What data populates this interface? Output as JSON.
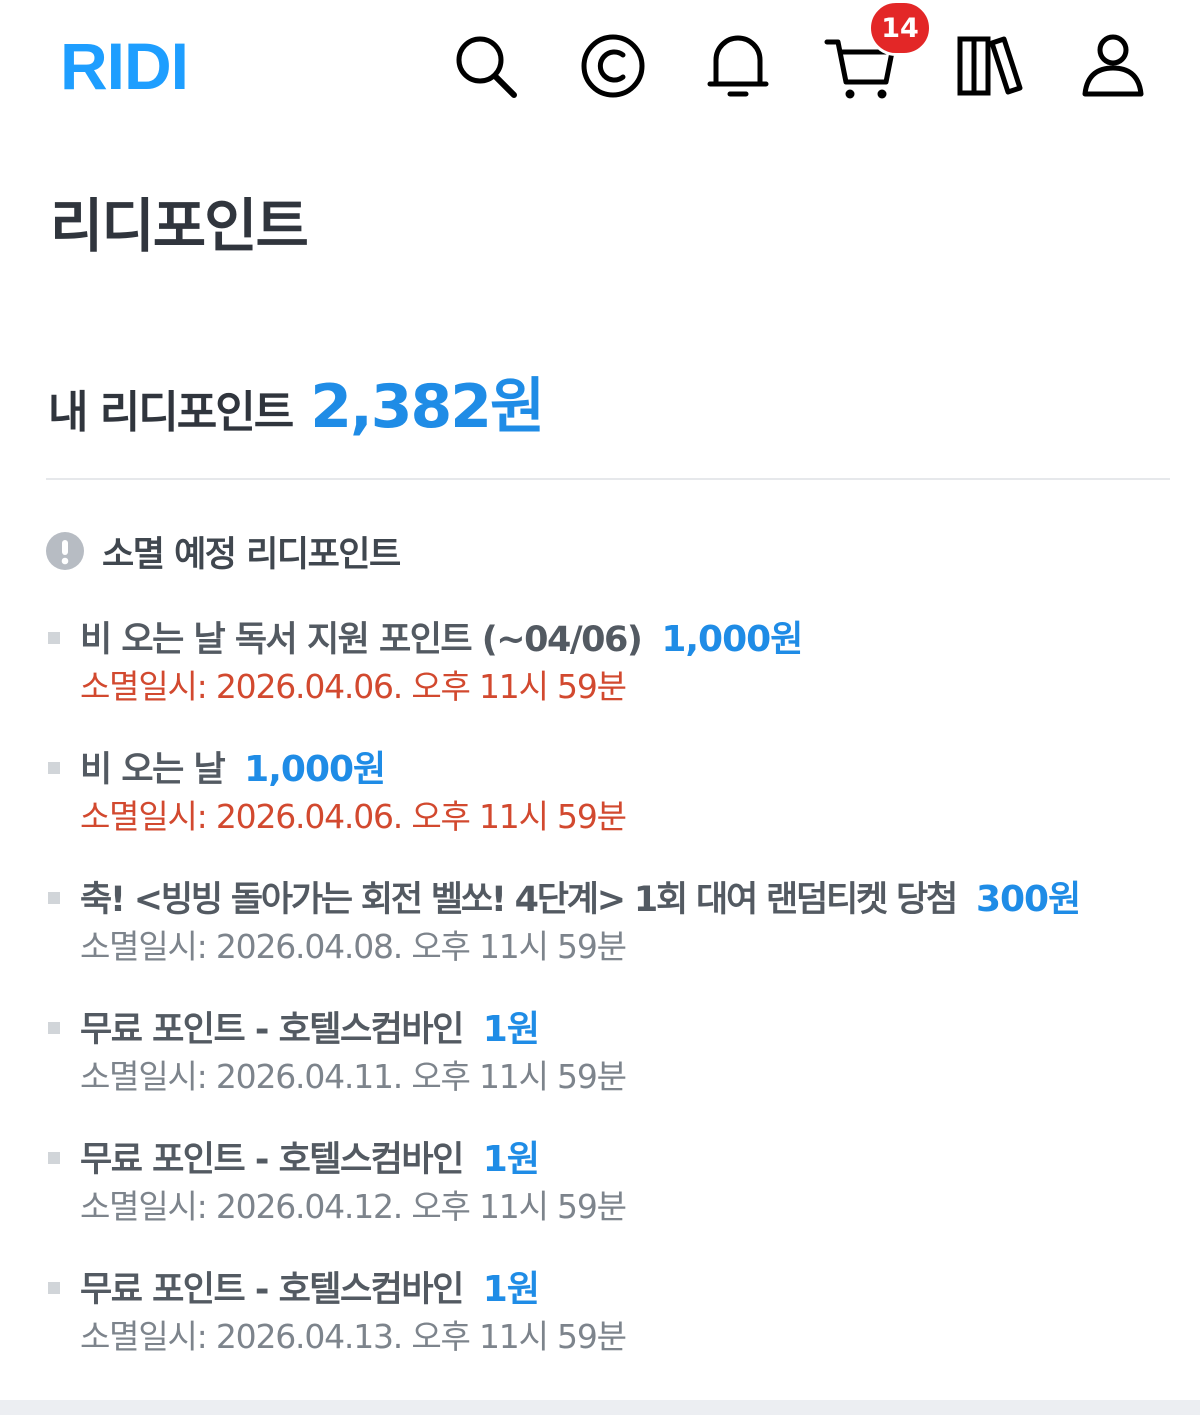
{
  "header": {
    "logo": "RIDI",
    "cart_badge": "14",
    "icons": [
      "search-icon",
      "copyright-cash-icon",
      "bell-icon",
      "cart-icon",
      "library-icon",
      "user-icon"
    ]
  },
  "page_title": "리디포인트",
  "my_points": {
    "label": "내 리디포인트",
    "amount": "2,382원"
  },
  "expiring": {
    "title": "소멸 예정 리디포인트",
    "items": [
      {
        "name": "비 오는 날 독서 지원 포인트 (~04/06)",
        "amount": "1,000원",
        "date": "소멸일시: 2026.04.06. 오후 11시 59분",
        "urgent": true
      },
      {
        "name": "비 오는 날",
        "amount": "1,000원",
        "date": "소멸일시: 2026.04.06. 오후 11시 59분",
        "urgent": true
      },
      {
        "name": "축! <빙빙 돌아가는 회전 벨쏘! 4단계> 1회 대여 랜덤티켓 당첨",
        "amount": "300원",
        "date": "소멸일시: 2026.04.08. 오후 11시 59분",
        "urgent": false
      },
      {
        "name": "무료 포인트 - 호텔스컴바인",
        "amount": "1원",
        "date": "소멸일시: 2026.04.11. 오후 11시 59분",
        "urgent": false
      },
      {
        "name": "무료 포인트 - 호텔스컴바인",
        "amount": "1원",
        "date": "소멸일시: 2026.04.12. 오후 11시 59분",
        "urgent": false
      },
      {
        "name": "무료 포인트 - 호텔스컴바인",
        "amount": "1원",
        "date": "소멸일시: 2026.04.13. 오후 11시 59분",
        "urgent": false
      }
    ]
  },
  "colors": {
    "brand": "#1e9eff",
    "amount": "#1f8ce6",
    "urgent": "#d2492f",
    "badge": "#e32727"
  }
}
